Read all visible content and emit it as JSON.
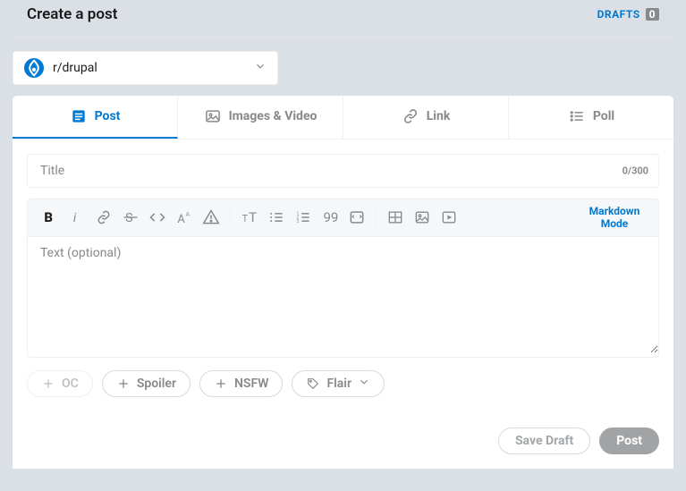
{
  "header": {
    "title": "Create a post",
    "drafts_label": "DRAFTS",
    "drafts_count": "0"
  },
  "community": {
    "name": "r/drupal"
  },
  "tabs": {
    "post": "Post",
    "images": "Images & Video",
    "link": "Link",
    "poll": "Poll"
  },
  "title_field": {
    "placeholder": "Title",
    "counter": "0/300"
  },
  "body_field": {
    "placeholder": "Text (optional)"
  },
  "toolbar": {
    "markdown": "Markdown Mode"
  },
  "tags": {
    "oc": "OC",
    "spoiler": "Spoiler",
    "nsfw": "NSFW",
    "flair": "Flair"
  },
  "actions": {
    "save_draft": "Save Draft",
    "post": "Post"
  }
}
